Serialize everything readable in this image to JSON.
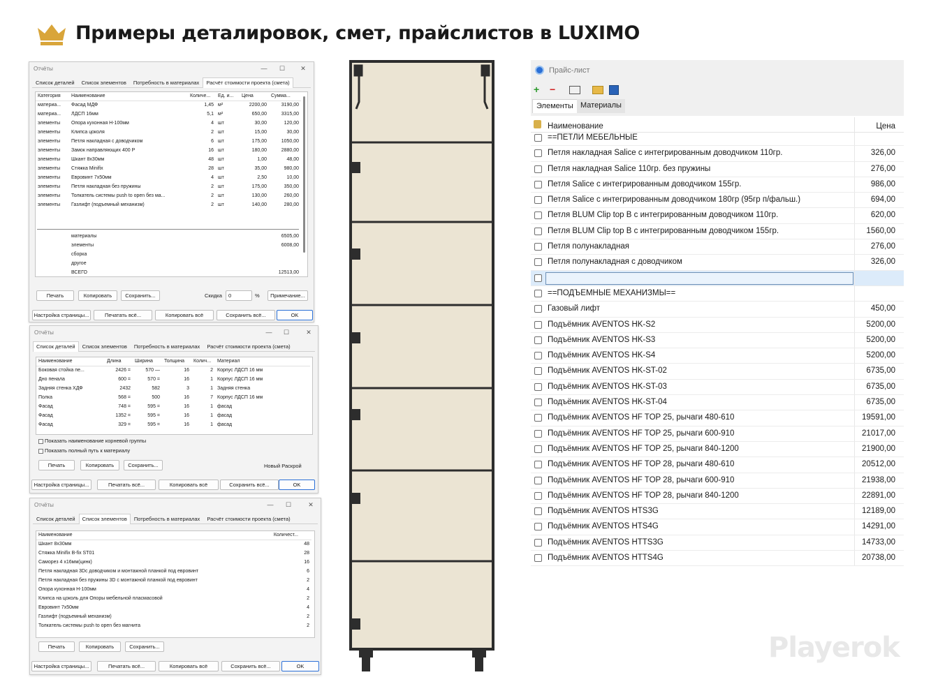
{
  "page": {
    "title": "Примеры деталировок, смет, прайслистов в LUXIMO",
    "watermark": "Playerok"
  },
  "colors": {
    "crown": "#d9a53a",
    "cabinet_fill": "#ebe4d3",
    "cabinet_frame": "#2d2d2d",
    "accent": "#2a6fd6"
  },
  "win_common": {
    "title": "Отчёты",
    "tabs": [
      "Список деталей",
      "Список элементов",
      "Потребность в материалах",
      "Расчёт стоимости проекта (смета)"
    ],
    "print": "Печать",
    "copy": "Копировать",
    "save": "Сохранить...",
    "page_setup": "Настройка страницы...",
    "print_all": "Печатать всё...",
    "copy_all": "Копировать всё",
    "save_all": "Сохранить всё...",
    "ok": "OK"
  },
  "estimate": {
    "columns": [
      "Категория",
      "Наименование",
      "Количе...",
      "Ед. и...",
      "Цена",
      "Сумма..."
    ],
    "rows": [
      [
        "материа...",
        "Фасад МДФ",
        "1,45",
        "м²",
        "2200,00",
        "3190,00"
      ],
      [
        "материа...",
        "ЛДСП 16мм",
        "5,1",
        "м²",
        "650,00",
        "3315,00"
      ],
      [
        "элементы",
        "Опора кухонная H-100мм",
        "4",
        "шт",
        "30,00",
        "120,00"
      ],
      [
        "элементы",
        "Клипса цоколя",
        "2",
        "шт",
        "15,00",
        "30,00"
      ],
      [
        "элементы",
        "Петля накладная с доводчиком",
        "6",
        "шт",
        "175,00",
        "1050,00"
      ],
      [
        "элементы",
        "Замок направляющих 400 Р",
        "16",
        "шт",
        "180,00",
        "2880,00"
      ],
      [
        "элементы",
        "Шкант 8х30мм",
        "48",
        "шт",
        "1,00",
        "48,00"
      ],
      [
        "элементы",
        "Стяжка Minifix",
        "28",
        "шт",
        "35,00",
        "980,00"
      ],
      [
        "элементы",
        "Евровинт 7х50мм",
        "4",
        "шт",
        "2,50",
        "10,00"
      ],
      [
        "элементы",
        "Петля  накладная без пружины",
        "2",
        "шт",
        "175,00",
        "350,00"
      ],
      [
        "элементы",
        " Толкатель системы push to open без ма...",
        "2",
        "шт",
        "130,00",
        "260,00"
      ],
      [
        "элементы",
        "Газлифт (подъемный механизм)",
        "2",
        "шт",
        "140,00",
        "280,00"
      ]
    ],
    "totals": [
      [
        "материалы",
        "6505,00"
      ],
      [
        "элементы",
        "6008,00"
      ],
      [
        "сборка",
        ""
      ],
      [
        "другое",
        ""
      ],
      [
        "ВСЕГО",
        "12513,00"
      ]
    ],
    "discount_label": "Скидка",
    "discount_value": "0",
    "percent": "%",
    "note_button": "Примечание..."
  },
  "details": {
    "columns": [
      "Наименование",
      "Длина",
      "Ширина",
      "Толщина",
      "Колич...",
      "Материал"
    ],
    "rows": [
      [
        "Боковая стойка пе...",
        "2426 =",
        "570 —",
        "16",
        "2",
        "Корпус ЛДСП 16 мм"
      ],
      [
        "Дно пенала",
        "600 =",
        "570 =",
        "16",
        "1",
        "Корпус ЛДСП 16 мм"
      ],
      [
        "Задняя стенка ХДФ",
        "2432",
        "582",
        "3",
        "1",
        "Задняя стенка"
      ],
      [
        "Полка",
        "568 =",
        "500",
        "16",
        "7",
        "Корпус ЛДСП 16 мм"
      ],
      [
        "Фасад",
        "748 =",
        "595 =",
        "16",
        "1",
        "фасад"
      ],
      [
        "Фасад",
        "1352 =",
        "595 =",
        "16",
        "1",
        "фасад"
      ],
      [
        "Фасад",
        "329 =",
        "595 =",
        "16",
        "1",
        "фасад"
      ]
    ],
    "check1": "Показать наименование корневой группы",
    "check2": "Показать полный путь к материалу",
    "new_cut": "Новый Раскрой"
  },
  "elements": {
    "columns": [
      "Наименование",
      "Количест..."
    ],
    "rows": [
      [
        "Шкант 8х30мм",
        "48"
      ],
      [
        "Стяжка Minifix B-fix ST01",
        "28"
      ],
      [
        "Саморез 4 х16мм(цинк)",
        "16"
      ],
      [
        "Петля накладная 3Dс доводчиком и монтажной планкой под евровинт",
        "6"
      ],
      [
        "Петля  накладная без пружины 3D с монтажной планкой под евровинт",
        "2"
      ],
      [
        "Опора кухонная H-100мм",
        "4"
      ],
      [
        "Клипса на цоколь для Опоры мебельной пласмасовой",
        "2"
      ],
      [
        "Евровинт 7х50мм",
        "4"
      ],
      [
        "Газлифт (подъемный механизм)",
        "2"
      ],
      [
        " Толкатель системы push to open без магнита",
        "2"
      ]
    ]
  },
  "pricelist": {
    "title": "Прайс-лист",
    "tabs": [
      "Элементы",
      "Материалы"
    ],
    "col_name": "Наименование",
    "col_price": "Цена",
    "rows": [
      [
        "==ПЕТЛИ МЕБЕЛЬНЫЕ",
        ""
      ],
      [
        "Петля накладная Salice с интегрированным доводчиком 110гр.",
        "326,00"
      ],
      [
        "Петля накладная Salice 110гр. без пружины",
        "276,00"
      ],
      [
        "Петля Salice с интегрированным доводчиком 155гр.",
        "986,00"
      ],
      [
        "Петля Salice с интегрированным доводчиком 180гр (95гр п/фальш.)",
        "694,00"
      ],
      [
        "Петля  BLUM Clip top B с интегрированным доводчиком 110гр.",
        "620,00"
      ],
      [
        "Петля BLUM Clip top B с интегрированным доводчиком 155гр.",
        "1560,00"
      ],
      [
        "Петля полунакладная",
        "276,00"
      ],
      [
        "Петля полунакладная с доводчиком",
        "326,00"
      ],
      [
        "",
        ""
      ],
      [
        "==ПОДЪЕМНЫЕ МЕХАНИЗМЫ==",
        ""
      ],
      [
        "Газовый лифт",
        "450,00"
      ],
      [
        "Подъёмник AVENTOS HK-S2",
        "5200,00"
      ],
      [
        "Подъёмник AVENTOS HK-S3",
        "5200,00"
      ],
      [
        "Подъёмник AVENTOS HK-S4",
        "5200,00"
      ],
      [
        "Подъёмник AVENTOS HK-ST-02",
        "6735,00"
      ],
      [
        "Подъёмник AVENTOS HK-ST-03",
        "6735,00"
      ],
      [
        "Подъёмник AVENTOS HK-ST-04",
        "6735,00"
      ],
      [
        "Подъёмник AVENTOS HF TOP 25, рычаги 480-610",
        "19591,00"
      ],
      [
        "Подъёмник AVENTOS HF TOP 25, рычаги 600-910",
        "21017,00"
      ],
      [
        "Подъёмник AVENTOS HF TOP 25, рычаги 840-1200",
        "21900,00"
      ],
      [
        "Подъёмник AVENTOS HF TOP 28, рычаги 480-610",
        "20512,00"
      ],
      [
        "Подъёмник AVENTOS HF TOP 28, рычаги 600-910",
        "21938,00"
      ],
      [
        "Подъёмник AVENTOS HF TOP 28, рычаги 840-1200",
        "22891,00"
      ],
      [
        "Подъёмник AVENTOS HTS3G",
        "12189,00"
      ],
      [
        "Подъёмник AVENTOS HTS4G",
        "14291,00"
      ],
      [
        "Подъёмник AVENTOS HTTS3G",
        "14733,00"
      ],
      [
        "Подъёмник AVENTOS HTTS4G",
        "20738,00"
      ]
    ]
  }
}
